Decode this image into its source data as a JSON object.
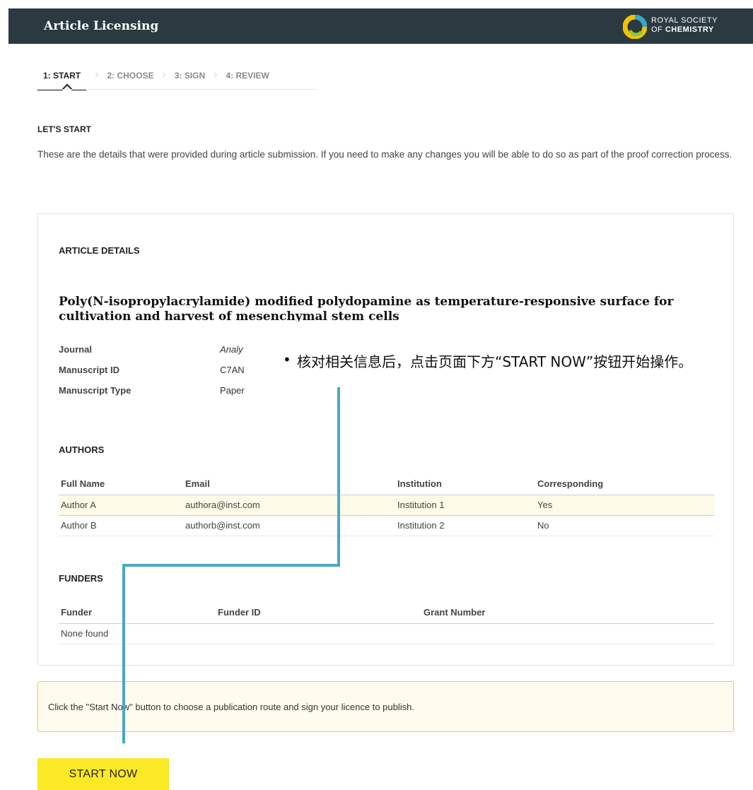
{
  "header": {
    "title": "Article Licensing",
    "logo_line1": "ROYAL SOCIETY",
    "logo_line2_prefix": "OF ",
    "logo_line2_bold": "CHEMISTRY"
  },
  "steps": [
    "1: START",
    "2: CHOOSE",
    "3: SIGN",
    "4: REVIEW"
  ],
  "intro": {
    "heading": "LET'S START",
    "text": "These are the details that were provided during article submission. If you need to make any changes you will be able to do so as part of the proof correction process."
  },
  "article": {
    "heading": "ARTICLE DETAILS",
    "title": "Poly(N-isopropylacrylamide) modified polydopamine as temperature-responsive surface for cultivation and harvest of mesenchymal stem cells",
    "details": [
      {
        "label": "Journal",
        "value": "Analy"
      },
      {
        "label": "Manuscript ID",
        "value": "C7AN"
      },
      {
        "label": "Manuscript Type",
        "value": "Paper"
      }
    ]
  },
  "authors": {
    "heading": "AUTHORS",
    "columns": [
      "Full Name",
      "Email",
      "Institution",
      "Corresponding"
    ],
    "rows": [
      [
        "Author A",
        "authora@inst.com",
        "Institution 1",
        "Yes"
      ],
      [
        "Author B",
        "authorb@inst.com",
        "Institution 2",
        "No"
      ]
    ]
  },
  "funders": {
    "heading": "FUNDERS",
    "columns": [
      "Funder",
      "Funder ID",
      "Grant Number"
    ],
    "empty": "None found"
  },
  "notice": "Click the \"Start Now\" button to choose a publication route and sign your licence to publish.",
  "start_button": "START NOW",
  "annotation": {
    "bullet": "•",
    "text": "核对相关信息后，点击页面下方“START NOW”按钮开始操作。",
    "color": "#4ba7c4"
  },
  "colors": {
    "header_bg": "#2b3a40",
    "button_bg": "#fbe925",
    "notice_bg": "#fffcef"
  }
}
